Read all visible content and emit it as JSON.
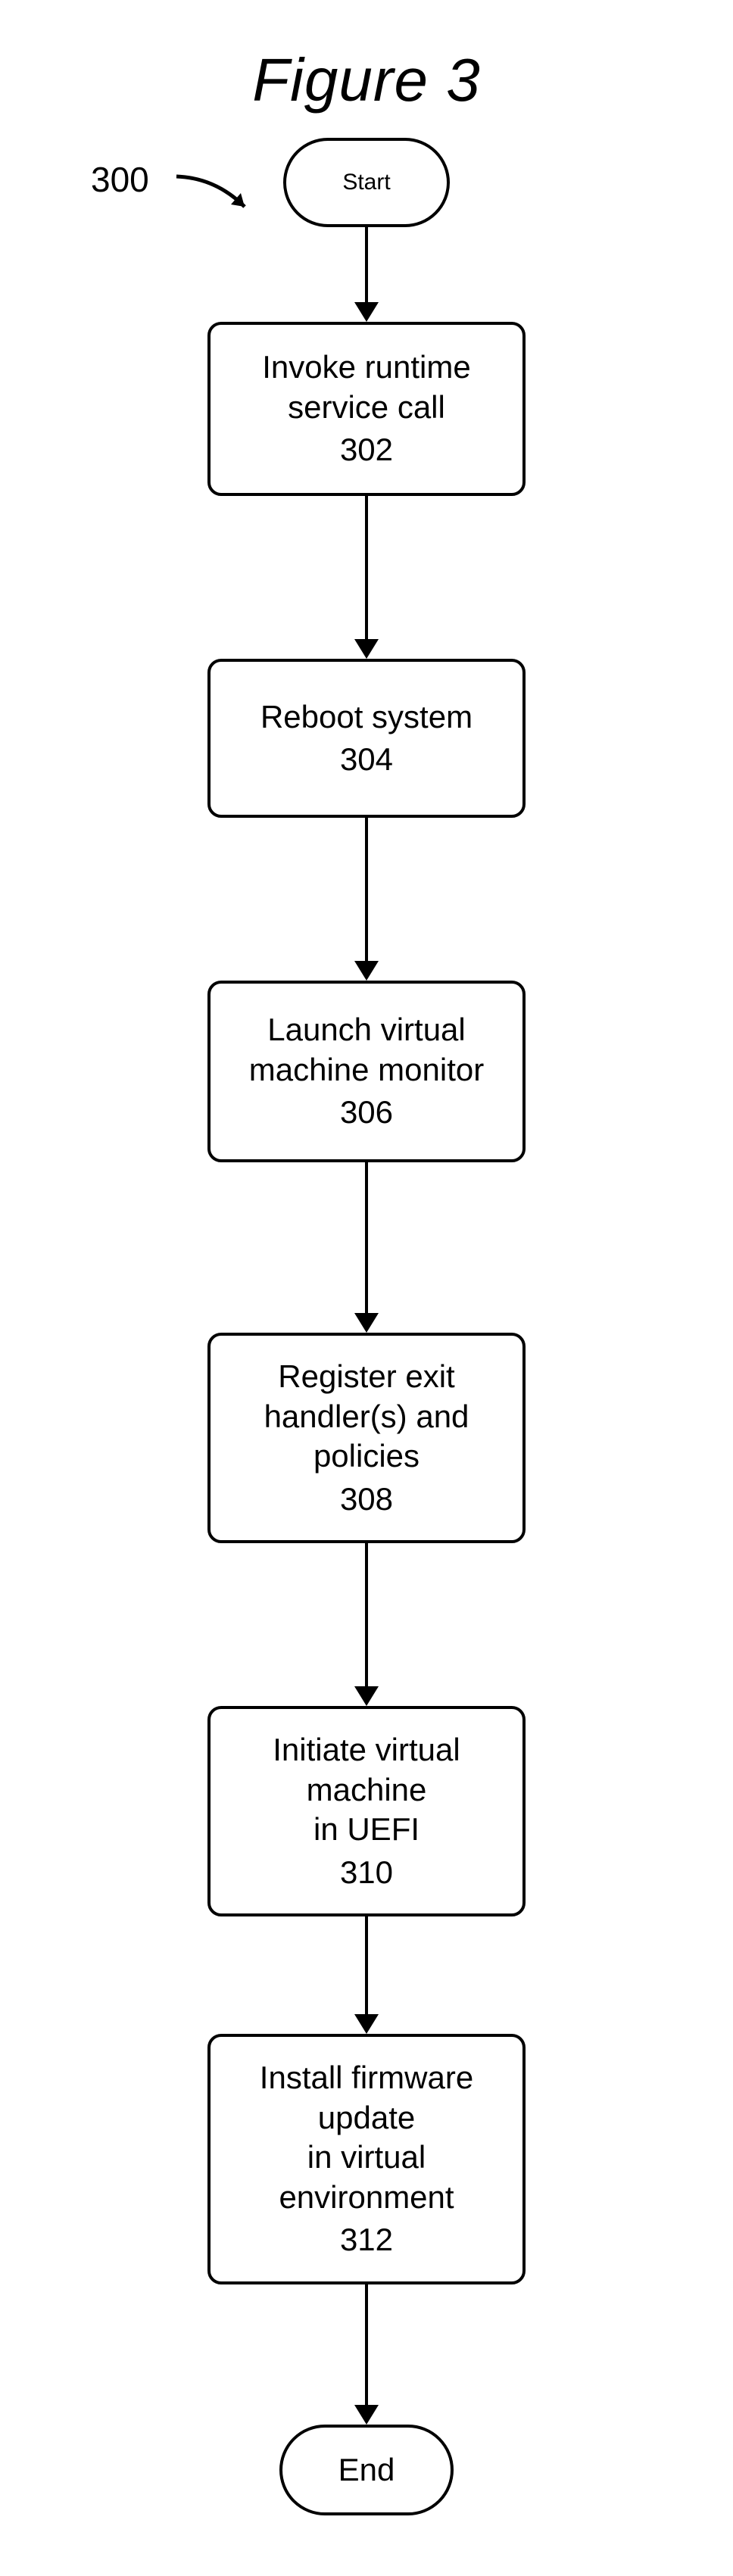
{
  "figure": {
    "title": "Figure 3",
    "ref_label": "300",
    "start_label": "Start",
    "end_label": "End"
  },
  "steps": [
    {
      "text": "Invoke runtime\nservice call",
      "id": "302",
      "min_h": 230
    },
    {
      "text": "Reboot system",
      "id": "304",
      "min_h": 210
    },
    {
      "text": "Launch virtual\nmachine monitor",
      "id": "306",
      "min_h": 240
    },
    {
      "text": "Register exit\nhandler(s) and policies",
      "id": "308",
      "min_h": 245
    },
    {
      "text": "Initiate virtual machine\nin UEFI",
      "id": "310",
      "min_h": 245
    },
    {
      "text": "Install firmware update\nin virtual environment",
      "id": "312",
      "min_h": 245
    }
  ],
  "connectors": {
    "after_start": 100,
    "between": [
      190,
      190,
      200,
      190,
      130,
      160
    ],
    "before_end": 160
  }
}
